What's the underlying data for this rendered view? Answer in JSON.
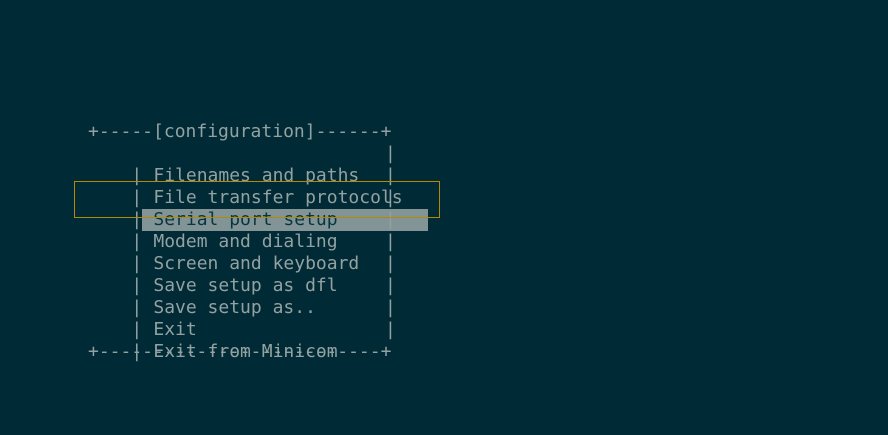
{
  "window": {
    "title": "configuration",
    "top_border": "+-----[configuration]------+",
    "bottom_border": "+--------------------------+"
  },
  "menu": {
    "selected_index": 2,
    "items": [
      {
        "label": "Filenames and paths"
      },
      {
        "label": "File transfer protocols"
      },
      {
        "label": "Serial port setup"
      },
      {
        "label": "Modem and dialing"
      },
      {
        "label": "Screen and keyboard"
      },
      {
        "label": "Save setup as dfl"
      },
      {
        "label": "Save setup as.."
      },
      {
        "label": "Exit"
      },
      {
        "label": "Exit from Minicom"
      }
    ]
  },
  "colors": {
    "background": "#002b36",
    "text": "#93a1a1",
    "highlight": "#839496",
    "focus_border": "#b58900"
  }
}
